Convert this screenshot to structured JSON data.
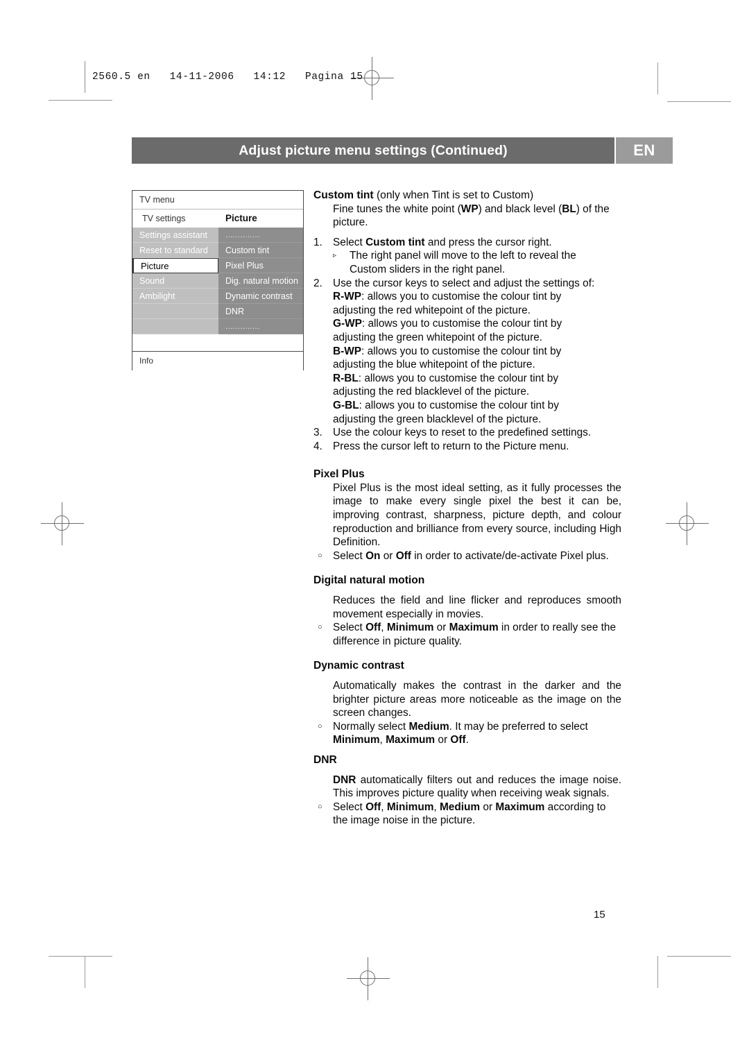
{
  "page_header": {
    "text": "2560.5 en   14-11-2006   14:12   Pagina 15"
  },
  "title_bar": {
    "title": "Adjust picture menu settings  (Continued)",
    "language_badge": "EN"
  },
  "tv_menu": {
    "title": "TV menu",
    "left_subtitle": "TV settings",
    "right_subtitle": "Picture",
    "left_items": [
      {
        "label": "Settings assistant",
        "state": "normal"
      },
      {
        "label": "Reset to standard",
        "state": "normal"
      },
      {
        "label": "Picture",
        "state": "selected"
      },
      {
        "label": "Sound",
        "state": "normal"
      },
      {
        "label": "Ambilight",
        "state": "normal"
      },
      {
        "label": "",
        "state": "blank"
      },
      {
        "label": "",
        "state": "blank"
      }
    ],
    "right_items": [
      {
        "label": "..............",
        "state": "dots"
      },
      {
        "label": "Custom tint",
        "state": "normal"
      },
      {
        "label": "Pixel Plus",
        "state": "normal"
      },
      {
        "label": "Dig. natural motion",
        "state": "normal"
      },
      {
        "label": "Dynamic contrast",
        "state": "normal"
      },
      {
        "label": "DNR",
        "state": "normal"
      },
      {
        "label": "..............",
        "state": "dots"
      }
    ],
    "info_label": "Info"
  },
  "content": {
    "custom_tint": {
      "heading_bold": "Custom tint",
      "heading_rest": "  (only when Tint is set to Custom)",
      "intro_1": "Fine tunes the white point (",
      "intro_wp": "WP",
      "intro_2": ") and black level (",
      "intro_bl": "BL",
      "intro_3": ") of the picture.",
      "step1_marker": "1.",
      "step1_a": "Select ",
      "step1_bold": "Custom tint",
      "step1_b": " and press the cursor right.",
      "step1_sub_marker": "▹",
      "step1_sub": "The right panel will move to the left to reveal the",
      "step1_sub_cont": "Custom sliders in the right panel.",
      "step2_marker": "2.",
      "step2": "Use the cursor keys to select and adjust the settings of:",
      "defs": [
        {
          "term": "R-WP",
          "line1": ": allows you to customise the colour tint by",
          "line2": "adjusting the red whitepoint of the picture."
        },
        {
          "term": "G-WP",
          "line1": ": allows you to customise the colour tint by",
          "line2": "adjusting the green whitepoint of the picture."
        },
        {
          "term": "B-WP",
          "line1": ": allows you to customise the colour tint by",
          "line2": "adjusting the blue whitepoint of the picture."
        },
        {
          "term": "R-BL",
          "line1": ": allows you to customise the colour tint by",
          "line2": "adjusting the red blacklevel of the picture."
        },
        {
          "term": "G-BL",
          "line1": ": allows you to customise the colour tint by",
          "line2": "adjusting the green blacklevel of the picture."
        }
      ],
      "step3_marker": "3.",
      "step3": "Use the colour keys to reset to the predefined settings.",
      "step4_marker": "4.",
      "step4": "Press the cursor left to return to the Picture menu."
    },
    "pixel_plus": {
      "heading": "Pixel Plus",
      "body": "Pixel Plus is the most ideal setting, as it fully processes the image to make every single pixel the best it can be, improving contrast, sharpness, picture depth, and colour reproduction and brilliance from every source, including High Definition.",
      "bullet_marker": "○",
      "bullet_a": "Select ",
      "bullet_on": "On",
      "bullet_b": " or ",
      "bullet_off": "Off",
      "bullet_c": " in order to activate/de-activate Pixel plus."
    },
    "digital_natural_motion": {
      "heading": "Digital natural motion",
      "body": "Reduces the field and line flicker and reproduces smooth movement especially in movies.",
      "bullet_marker": "○",
      "bullet_a": "Select ",
      "bullet_off": "Off",
      "bullet_b": ", ",
      "bullet_min": "Minimum",
      "bullet_c": " or ",
      "bullet_max": "Maximum",
      "bullet_d": " in order to really see the difference in picture quality."
    },
    "dynamic_contrast": {
      "heading": "Dynamic contrast",
      "body": "Automatically makes the contrast in the darker and the brighter picture areas more noticeable as the image on the screen changes.",
      "bullet_marker": "○",
      "bullet_a": "Normally select ",
      "bullet_medium": "Medium",
      "bullet_b": ". It may be preferred to select ",
      "bullet_min": "Minimum",
      "bullet_c": ", ",
      "bullet_max": "Maximum",
      "bullet_d": " or ",
      "bullet_off": "Off",
      "bullet_e": "."
    },
    "dnr": {
      "heading": "DNR",
      "body_bold": "DNR",
      "body": " automatically filters out and reduces the image noise. This improves picture quality when receiving weak signals.",
      "bullet_marker": "○",
      "bullet_a": "Select ",
      "bullet_off": "Off",
      "bullet_b": ", ",
      "bullet_min": "Minimum",
      "bullet_c": ", ",
      "bullet_medium": "Medium",
      "bullet_d": " or ",
      "bullet_max": "Maximum",
      "bullet_e": " according to the image noise in the picture."
    }
  },
  "page_number": "15"
}
